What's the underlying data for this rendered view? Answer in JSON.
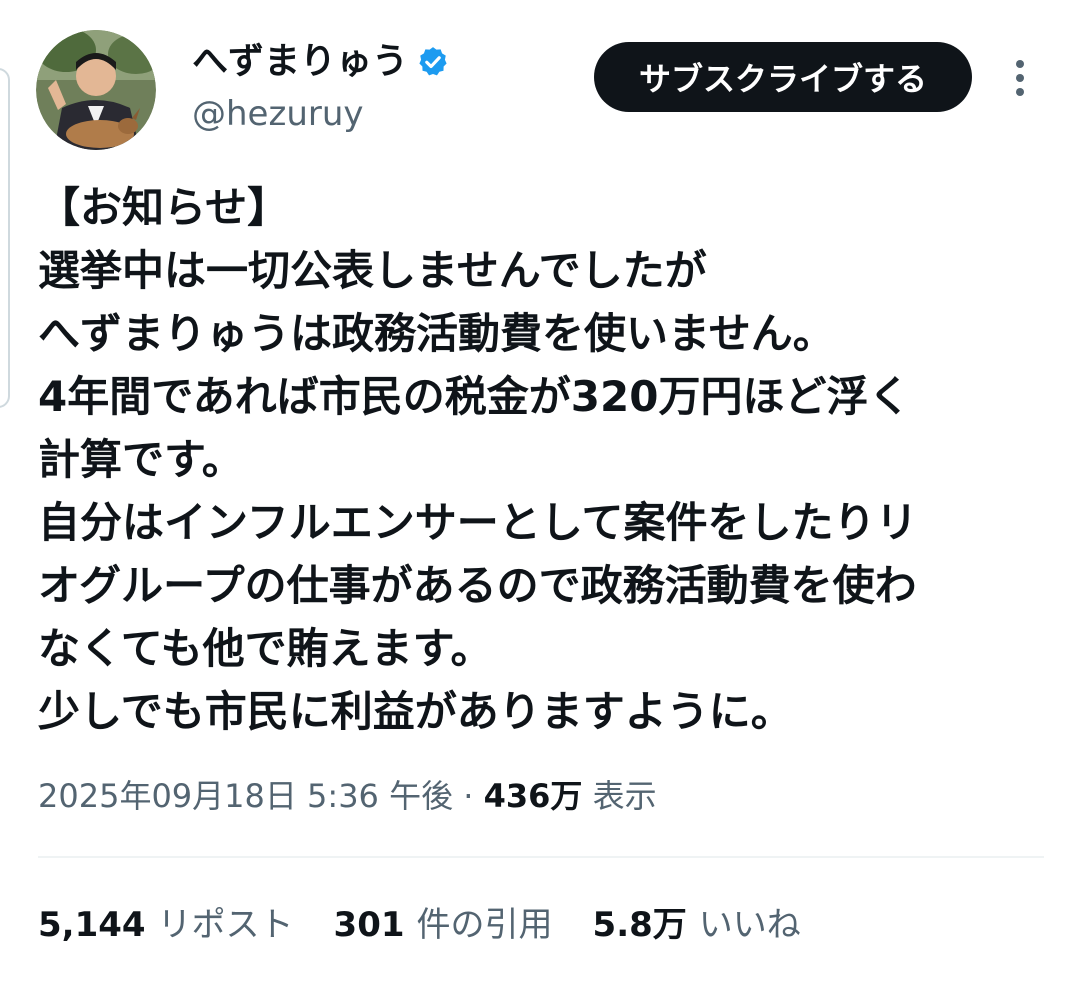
{
  "author": {
    "display_name": "へずまりゅう",
    "handle": "@hezuruy",
    "verified": true,
    "avatar_icon": "avatar-photo-icon",
    "verified_icon": "verified-badge-icon"
  },
  "header": {
    "subscribe_label": "サブスクライブする",
    "more_icon": "more-vertical-icon"
  },
  "tweet": {
    "lines": [
      "【お知らせ】",
      "選挙中は一切公表しませんでしたが",
      "へずまりゅうは政務活動費を使いません。",
      "4年間であれば市民の税金が320万円ほど浮く",
      "計算です。",
      "自分はインフルエンサーとして案件をしたりリ",
      "オグループの仕事があるので政務活動費を使わ",
      "なくても他で賄えます。",
      "少しでも市民に利益がありますように。"
    ]
  },
  "meta": {
    "timestamp": "2025年09月18日 5:36 午後",
    "separator": " · ",
    "views_count": "436万",
    "views_label": " 表示"
  },
  "stats": {
    "reposts": {
      "count": "5,144",
      "label": "リポスト"
    },
    "quotes": {
      "count": "301",
      "label": "件の引用"
    },
    "likes": {
      "count": "5.8万",
      "label": "いいね"
    }
  },
  "colors": {
    "text": "#0f1419",
    "secondary": "#536471",
    "verified": "#1d9bf0",
    "divider": "#eff3f4",
    "button_bg": "#0f1419"
  }
}
